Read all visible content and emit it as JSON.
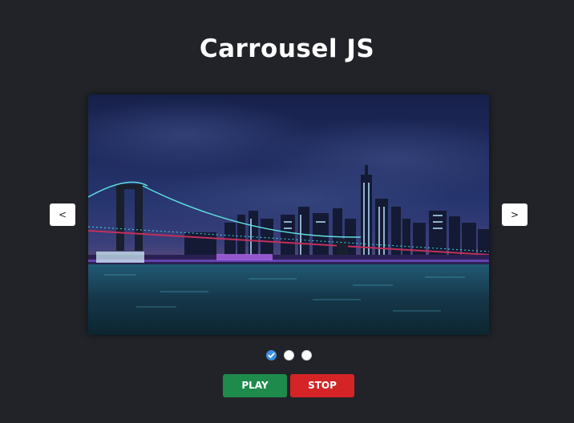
{
  "header": {
    "title": "Carrousel JS"
  },
  "carousel": {
    "prev_label": "<",
    "next_label": ">",
    "slide_count": 3,
    "active_index": 0,
    "current_image": "new-york-skyline-brooklyn-bridge-night"
  },
  "controls": {
    "play_label": "PLAY",
    "stop_label": "STOP"
  },
  "colors": {
    "background": "#212328",
    "play": "#1e8a4c",
    "stop": "#d42426",
    "active_dot": "#3d8fe0"
  }
}
